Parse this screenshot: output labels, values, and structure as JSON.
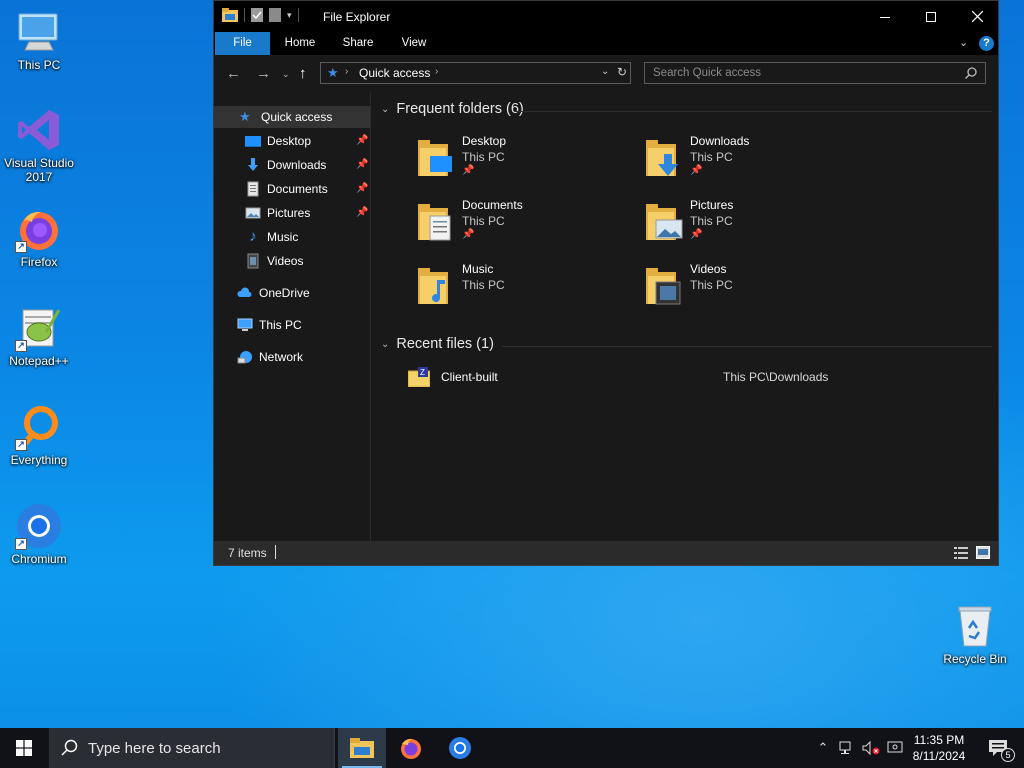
{
  "desktop": {
    "icons": [
      {
        "label": "This PC",
        "icon": "this-pc-icon"
      },
      {
        "label": "Visual Studio 2017",
        "icon": "visual-studio-icon"
      },
      {
        "label": "Firefox",
        "icon": "firefox-icon"
      },
      {
        "label": "Notepad++",
        "icon": "notepadpp-icon"
      },
      {
        "label": "Everything",
        "icon": "everything-icon"
      },
      {
        "label": "Chromium",
        "icon": "chromium-icon"
      },
      {
        "label": "Recycle Bin",
        "icon": "recycle-bin-icon"
      }
    ]
  },
  "explorer": {
    "title": "File Explorer",
    "ribbon_tabs": [
      "File",
      "Home",
      "Share",
      "View"
    ],
    "address": {
      "location": "Quick access"
    },
    "search": {
      "placeholder": "Search Quick access"
    },
    "nav": {
      "quick_access": "Quick access",
      "items": [
        {
          "label": "Desktop",
          "pinned": true
        },
        {
          "label": "Downloads",
          "pinned": true
        },
        {
          "label": "Documents",
          "pinned": true
        },
        {
          "label": "Pictures",
          "pinned": true
        },
        {
          "label": "Music",
          "pinned": false
        },
        {
          "label": "Videos",
          "pinned": false
        }
      ],
      "onedrive": "OneDrive",
      "this_pc": "This PC",
      "network": "Network"
    },
    "frequent": {
      "header": "Frequent folders (6)",
      "folders": [
        {
          "name": "Desktop",
          "location": "This PC",
          "pinned": true
        },
        {
          "name": "Downloads",
          "location": "This PC",
          "pinned": true
        },
        {
          "name": "Documents",
          "location": "This PC",
          "pinned": true
        },
        {
          "name": "Pictures",
          "location": "This PC",
          "pinned": true
        },
        {
          "name": "Music",
          "location": "This PC",
          "pinned": false
        },
        {
          "name": "Videos",
          "location": "This PC",
          "pinned": false
        }
      ]
    },
    "recent": {
      "header": "Recent files (1)",
      "files": [
        {
          "name": "Client-built",
          "path": "This PC\\Downloads"
        }
      ]
    },
    "status": {
      "items": "7 items"
    }
  },
  "taskbar": {
    "search_placeholder": "Type here to search",
    "time": "11:35 PM",
    "date": "8/11/2024",
    "notification_count": "5"
  },
  "colors": {
    "accent": "#1979ca",
    "folder_yellow": "#f2c55c",
    "window_bg": "#191919",
    "taskbar_bg": "#101218"
  }
}
